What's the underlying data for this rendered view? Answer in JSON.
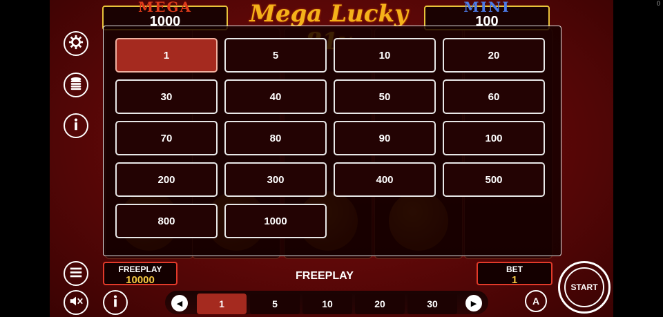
{
  "jackpots": {
    "mega": {
      "label": "MEGA",
      "value": "1000"
    },
    "mini": {
      "label": "MINI",
      "value": "100"
    }
  },
  "logo_text": "Mega Lucky 81x",
  "corner_text": "0",
  "bet_options": [
    "1",
    "5",
    "10",
    "20",
    "30",
    "40",
    "50",
    "60",
    "70",
    "80",
    "90",
    "100",
    "200",
    "300",
    "400",
    "500",
    "800",
    "1000"
  ],
  "selected_bet": "1",
  "side_icons": {
    "settings": "gear-icon",
    "coins": "coin-stack-icon",
    "info": "info-icon",
    "menu": "menu-icon",
    "sound": "sound-muted-icon",
    "info_bottom": "info-icon"
  },
  "freeplay_box": {
    "label": "FREEPLAY",
    "value": "10000"
  },
  "mode_text": "FREEPLAY",
  "bet_box": {
    "label": "BET",
    "value": "1"
  },
  "quick_bets": [
    "1",
    "5",
    "10",
    "20",
    "30"
  ],
  "quick_selected": "1",
  "auto_label": "A",
  "start_label": "START",
  "colors": {
    "accent": "#a52a1f",
    "gold": "#f5c842",
    "border_red": "#e23a2a"
  }
}
